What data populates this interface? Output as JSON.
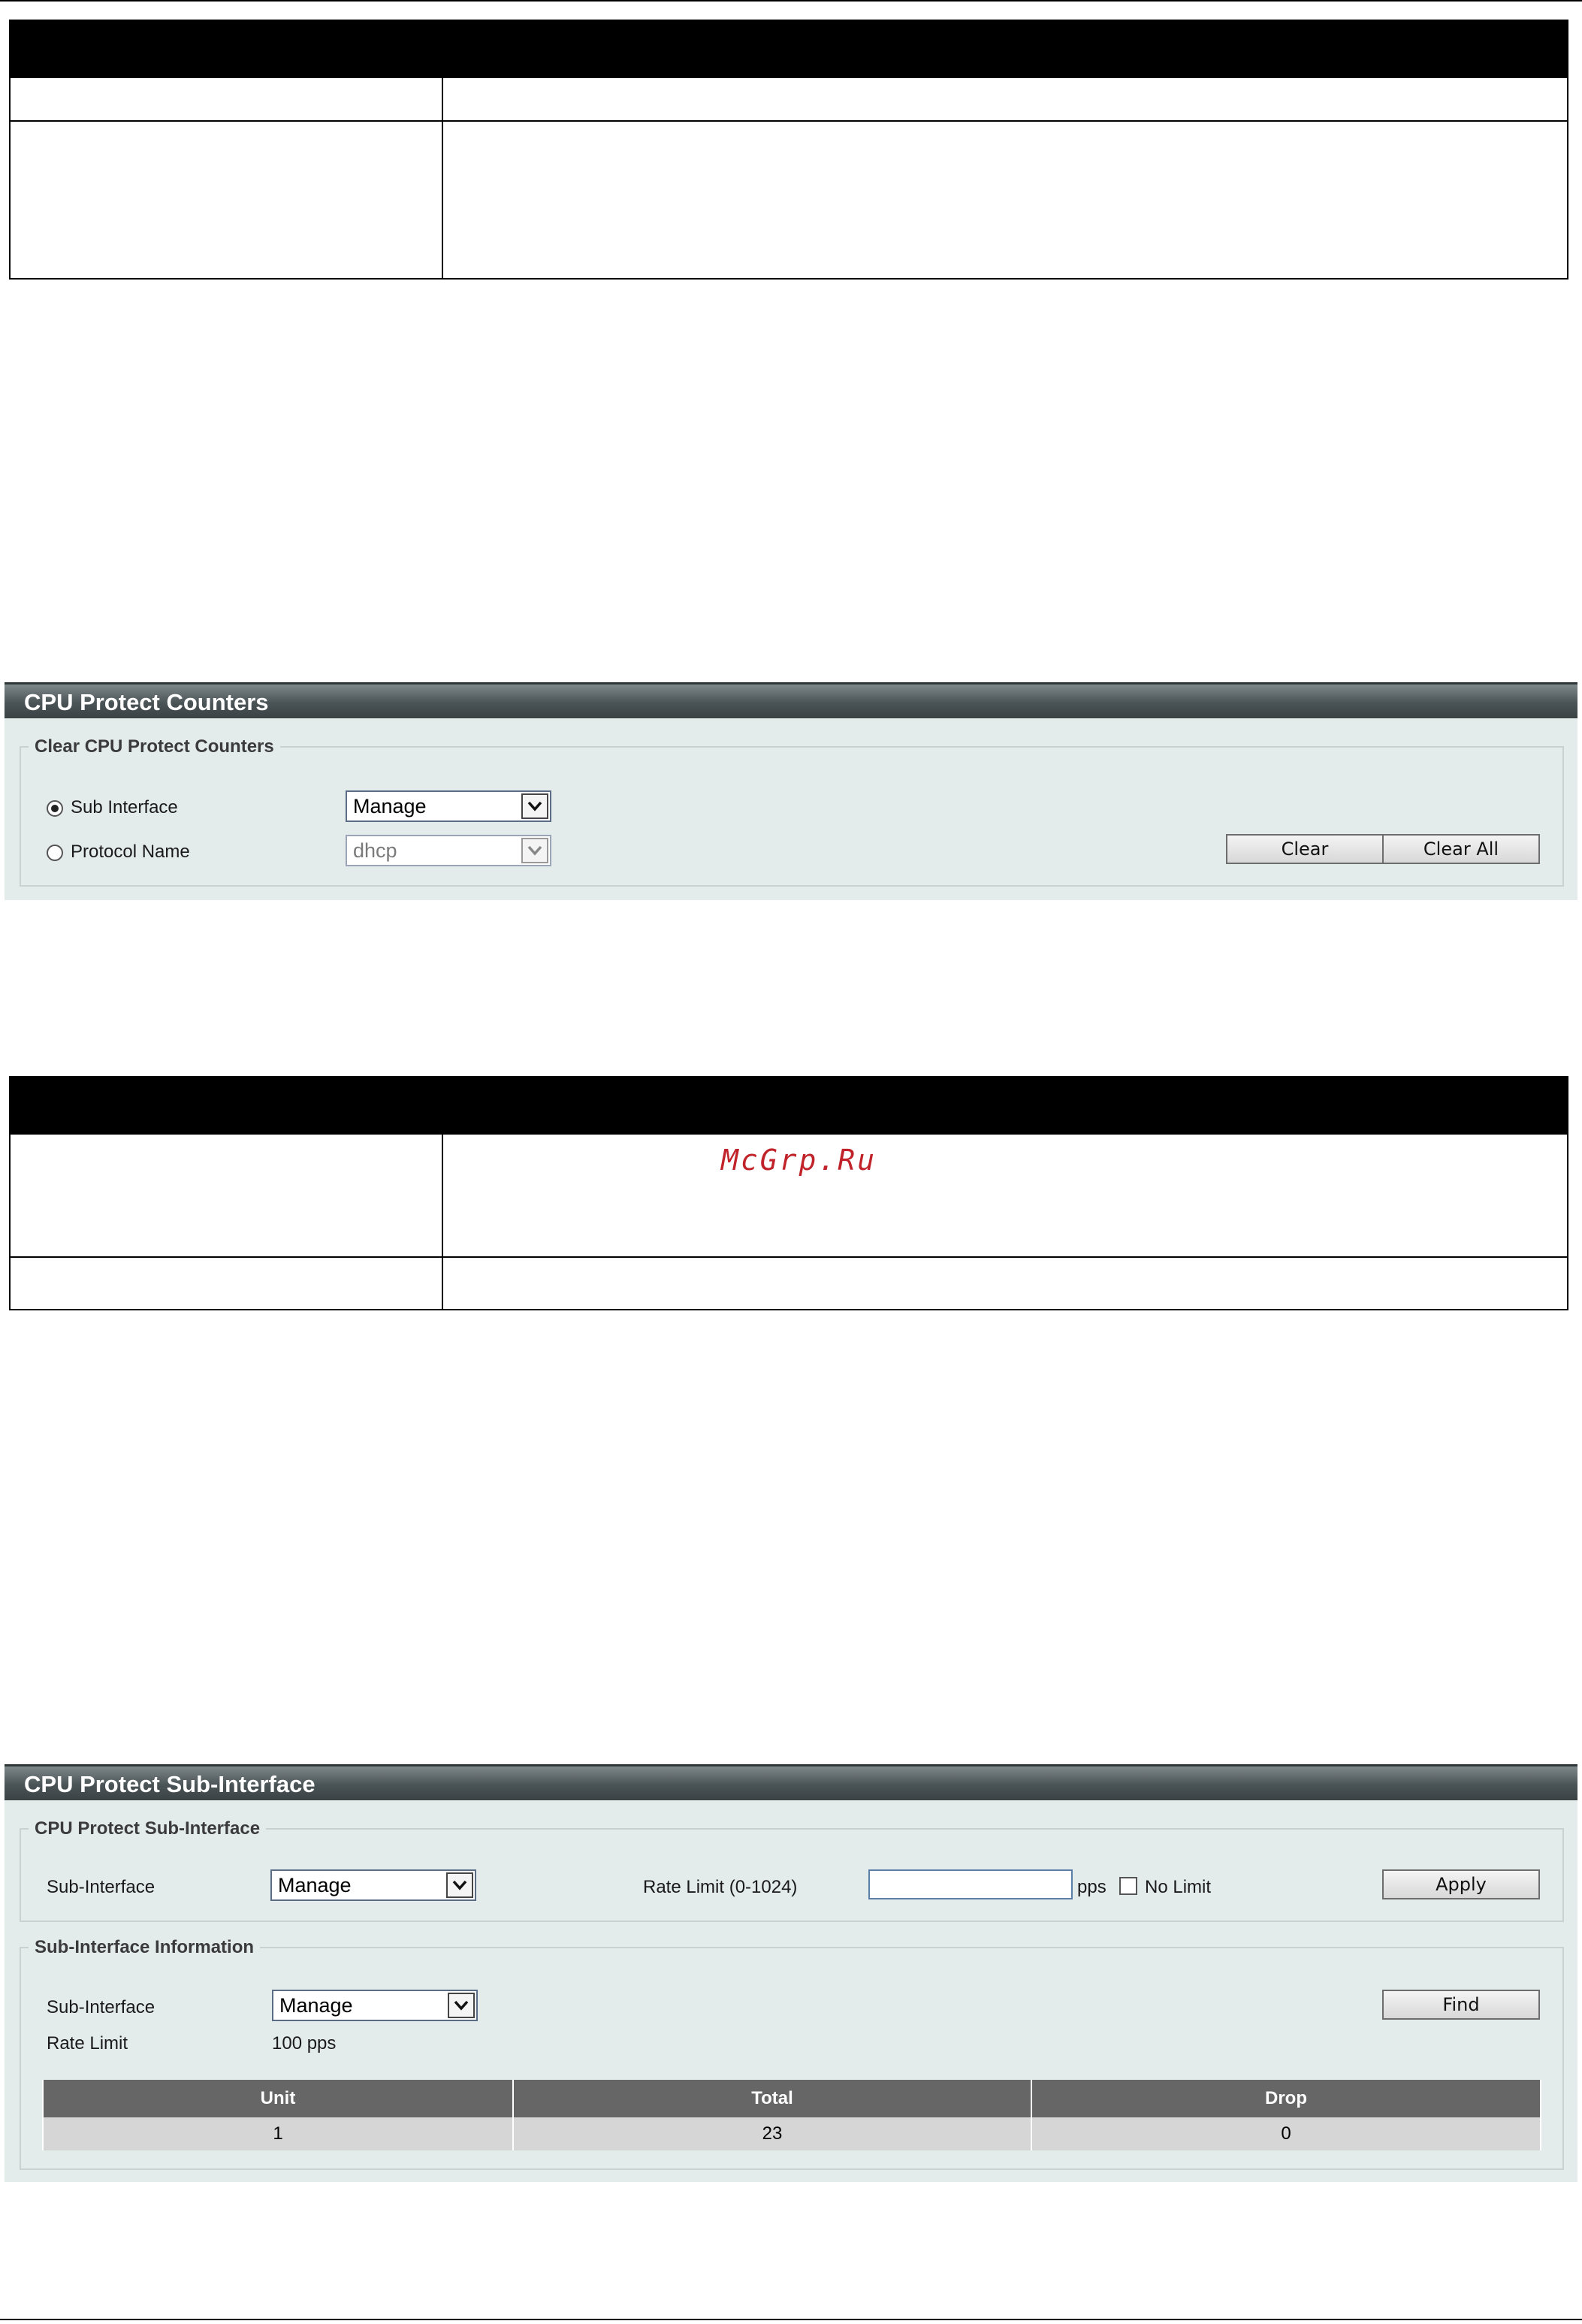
{
  "watermark": "McGrp.Ru",
  "counters_panel": {
    "title": "CPU Protect Counters",
    "group_title": "Clear CPU Protect Counters",
    "sub_interface_label": "Sub Interface",
    "sub_interface_value": "Manage",
    "protocol_name_label": "Protocol Name",
    "protocol_name_value": "dhcp",
    "clear_button": "Clear",
    "clear_all_button": "Clear All"
  },
  "subif_panel": {
    "title": "CPU Protect Sub-Interface",
    "config_group_title": "CPU Protect Sub-Interface",
    "sub_interface_label": "Sub-Interface",
    "sub_interface_value": "Manage",
    "rate_limit_label": "Rate Limit (0-1024)",
    "rate_limit_value": "",
    "pps_label": "pps",
    "no_limit_label": "No Limit",
    "apply_button": "Apply",
    "info_group_title": "Sub-Interface Information",
    "info_sub_interface_label": "Sub-Interface",
    "info_sub_interface_value": "Manage",
    "find_button": "Find",
    "info_rate_limit_label": "Rate Limit",
    "info_rate_limit_value": "100 pps",
    "table": {
      "headers": [
        "Unit",
        "Total",
        "Drop"
      ],
      "rows": [
        [
          "1",
          "23",
          "0"
        ]
      ]
    }
  }
}
